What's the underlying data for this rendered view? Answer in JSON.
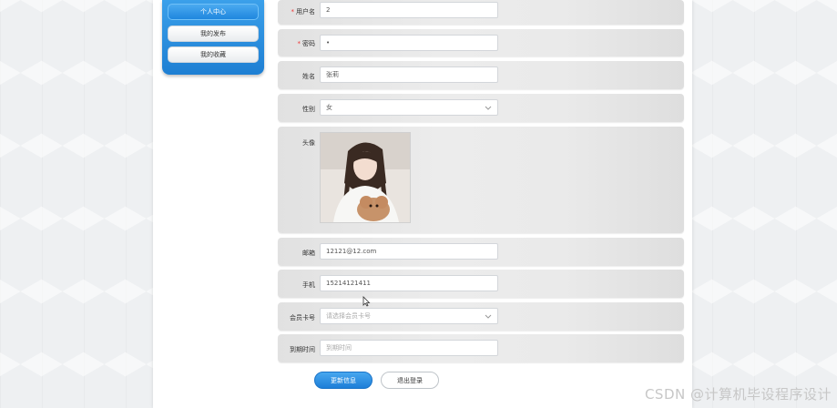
{
  "sidebar": {
    "items": [
      {
        "label": "个人中心",
        "active": true
      },
      {
        "label": "我的发布",
        "active": false
      },
      {
        "label": "我的收藏",
        "active": false
      }
    ]
  },
  "form": {
    "username": {
      "label": "用户名",
      "required": true,
      "value": "2"
    },
    "password": {
      "label": "密码",
      "required": true,
      "value": "•"
    },
    "name": {
      "label": "姓名",
      "value": "张莉"
    },
    "gender": {
      "label": "性别",
      "value": "女"
    },
    "avatar": {
      "label": "头像"
    },
    "email": {
      "label": "邮箱",
      "value": "12121@12.com"
    },
    "phone": {
      "label": "手机",
      "value": "15214121411"
    },
    "member_card": {
      "label": "会员卡号",
      "placeholder": "请选择会员卡号"
    },
    "expire": {
      "label": "到期时间",
      "placeholder": "到期时间"
    }
  },
  "actions": {
    "update_label": "更新信息",
    "logout_label": "退出登录"
  },
  "watermark": "CSDN @计算机毕设程序设计",
  "colors": {
    "accent": "#1e7fd3",
    "required": "#e33333"
  }
}
